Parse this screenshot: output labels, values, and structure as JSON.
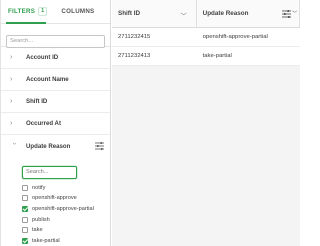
{
  "filters_panel": {
    "tabs": [
      {
        "label": "FILTERS",
        "count": "1"
      },
      {
        "label": "COLUMNS"
      }
    ],
    "search_placeholder": "Search...",
    "groups": [
      {
        "label": "Account ID"
      },
      {
        "label": "Account Name"
      },
      {
        "label": "Shift ID"
      },
      {
        "label": "Occurred At"
      }
    ],
    "expanded_group": {
      "label": "Update Reason",
      "search_placeholder": "Search...",
      "options": [
        {
          "label": "notify",
          "checked": false
        },
        {
          "label": "openshift-approve",
          "checked": false
        },
        {
          "label": "openshift-approve-partial",
          "checked": true
        },
        {
          "label": "publish",
          "checked": false
        },
        {
          "label": "take",
          "checked": false
        },
        {
          "label": "take-partial",
          "checked": true
        }
      ]
    }
  },
  "grid": {
    "columns": [
      {
        "label": "Shift ID"
      },
      {
        "label": "Update Reason"
      }
    ],
    "rows": [
      {
        "shift_id": "2711232415",
        "update_reason": "openshift-approve-partial"
      },
      {
        "shift_id": "2711232413",
        "update_reason": "take-partial"
      }
    ]
  },
  "colors": {
    "accent": "#2e9f4c"
  }
}
